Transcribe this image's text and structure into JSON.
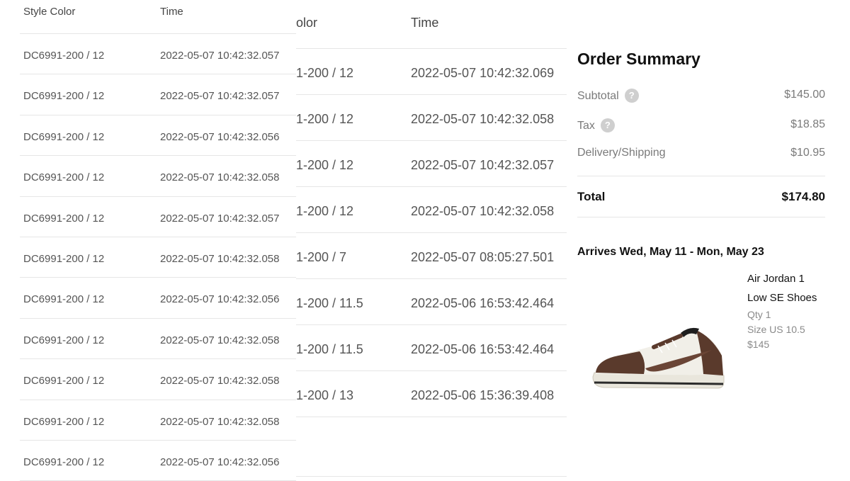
{
  "left_table": {
    "headers": [
      "Style Color",
      "Time"
    ],
    "rows": [
      [
        "DC6991-200 / 12",
        "2022-05-07 10:42:32.057"
      ],
      [
        "DC6991-200 / 12",
        "2022-05-07 10:42:32.057"
      ],
      [
        "DC6991-200 / 12",
        "2022-05-07 10:42:32.056"
      ],
      [
        "DC6991-200 / 12",
        "2022-05-07 10:42:32.058"
      ],
      [
        "DC6991-200 / 12",
        "2022-05-07 10:42:32.057"
      ],
      [
        "DC6991-200 / 12",
        "2022-05-07 10:42:32.058"
      ],
      [
        "DC6991-200 / 12",
        "2022-05-07 10:42:32.056"
      ],
      [
        "DC6991-200 / 12",
        "2022-05-07 10:42:32.058"
      ],
      [
        "DC6991-200 / 12",
        "2022-05-07 10:42:32.058"
      ],
      [
        "DC6991-200 / 12",
        "2022-05-07 10:42:32.058"
      ],
      [
        "DC6991-200 / 12",
        "2022-05-07 10:42:32.056"
      ]
    ]
  },
  "middle_table": {
    "headers": [
      "olor",
      "Time"
    ],
    "rows": [
      [
        "1-200 / 12",
        "2022-05-07 10:42:32.069"
      ],
      [
        "1-200 / 12",
        "2022-05-07 10:42:32.058"
      ],
      [
        "1-200 / 12",
        "2022-05-07 10:42:32.057"
      ],
      [
        "1-200 / 12",
        "2022-05-07 10:42:32.058"
      ],
      [
        "1-200 / 7",
        "2022-05-07 08:05:27.501"
      ],
      [
        "1-200 / 11.5",
        "2022-05-06 16:53:42.464"
      ],
      [
        "1-200 / 11.5",
        "2022-05-06 16:53:42.464"
      ],
      [
        "1-200 / 13",
        "2022-05-06 15:36:39.408"
      ]
    ]
  },
  "summary": {
    "title": "Order Summary",
    "subtotal_label": "Subtotal",
    "subtotal_value": "$145.00",
    "tax_label": "Tax",
    "tax_value": "$18.85",
    "shipping_label": "Delivery/Shipping",
    "shipping_value": "$10.95",
    "help_glyph": "?",
    "total_label": "Total",
    "total_value": "$174.80",
    "arrives": "Arrives Wed, May 11 - Mon, May 23",
    "product": {
      "name_line1": "Air Jordan 1",
      "name_line2": "Low SE Shoes",
      "qty": "Qty 1",
      "size": "Size US 10.5",
      "price": "$145",
      "image_icon": "sneaker-image"
    }
  },
  "colors": {
    "shoe_brown": "#5a3a2c",
    "shoe_white": "#f1efe8",
    "text_muted": "#7a7a7a",
    "divider": "#e5e5e5"
  }
}
